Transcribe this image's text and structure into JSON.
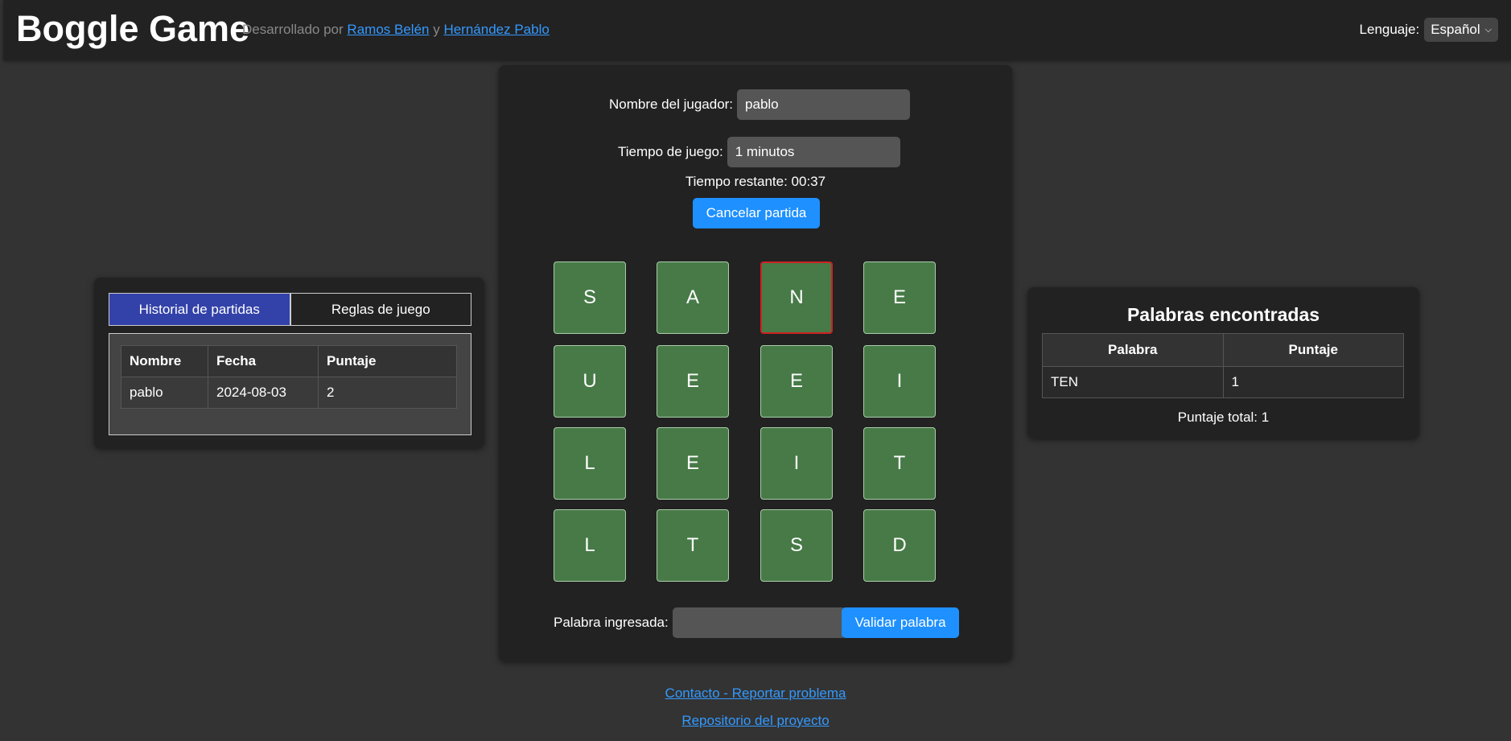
{
  "header": {
    "title": "Boggle Game",
    "dev_prefix": "Desarrollado por",
    "dev_author1": "Ramos Belén",
    "dev_join": "y",
    "dev_author2": "Hernández Pablo",
    "lang_label": "Lenguaje:",
    "lang_value": "Español"
  },
  "history": {
    "tab_history": "Historial de partidas",
    "tab_rules": "Reglas de juego",
    "columns": [
      "Nombre",
      "Fecha",
      "Puntaje"
    ],
    "rows": [
      {
        "name": "pablo",
        "date": "2024-08-03",
        "score": "2"
      }
    ]
  },
  "game": {
    "player_label": "Nombre del jugador:",
    "player_value": "pablo",
    "time_label": "Tiempo de juego:",
    "time_value": "1 minutos",
    "remaining": "Tiempo restante: 00:37",
    "cancel_label": "Cancelar partida",
    "board": [
      "S",
      "A",
      "N",
      "E",
      "U",
      "E",
      "E",
      "I",
      "L",
      "E",
      "I",
      "T",
      "L",
      "T",
      "S",
      "D"
    ],
    "selected_index": 2,
    "word_label": "Palabra ingresada:",
    "word_value": "",
    "validate_label": "Validar palabra"
  },
  "found": {
    "title": "Palabras encontradas",
    "col_word": "Palabra",
    "col_score": "Puntaje",
    "rows": [
      {
        "word": "TEN",
        "score": "1"
      }
    ],
    "total": "Puntaje total: 1"
  },
  "footer": {
    "contact": "Contacto - Reportar problema",
    "repo": "Repositorio del proyecto"
  }
}
